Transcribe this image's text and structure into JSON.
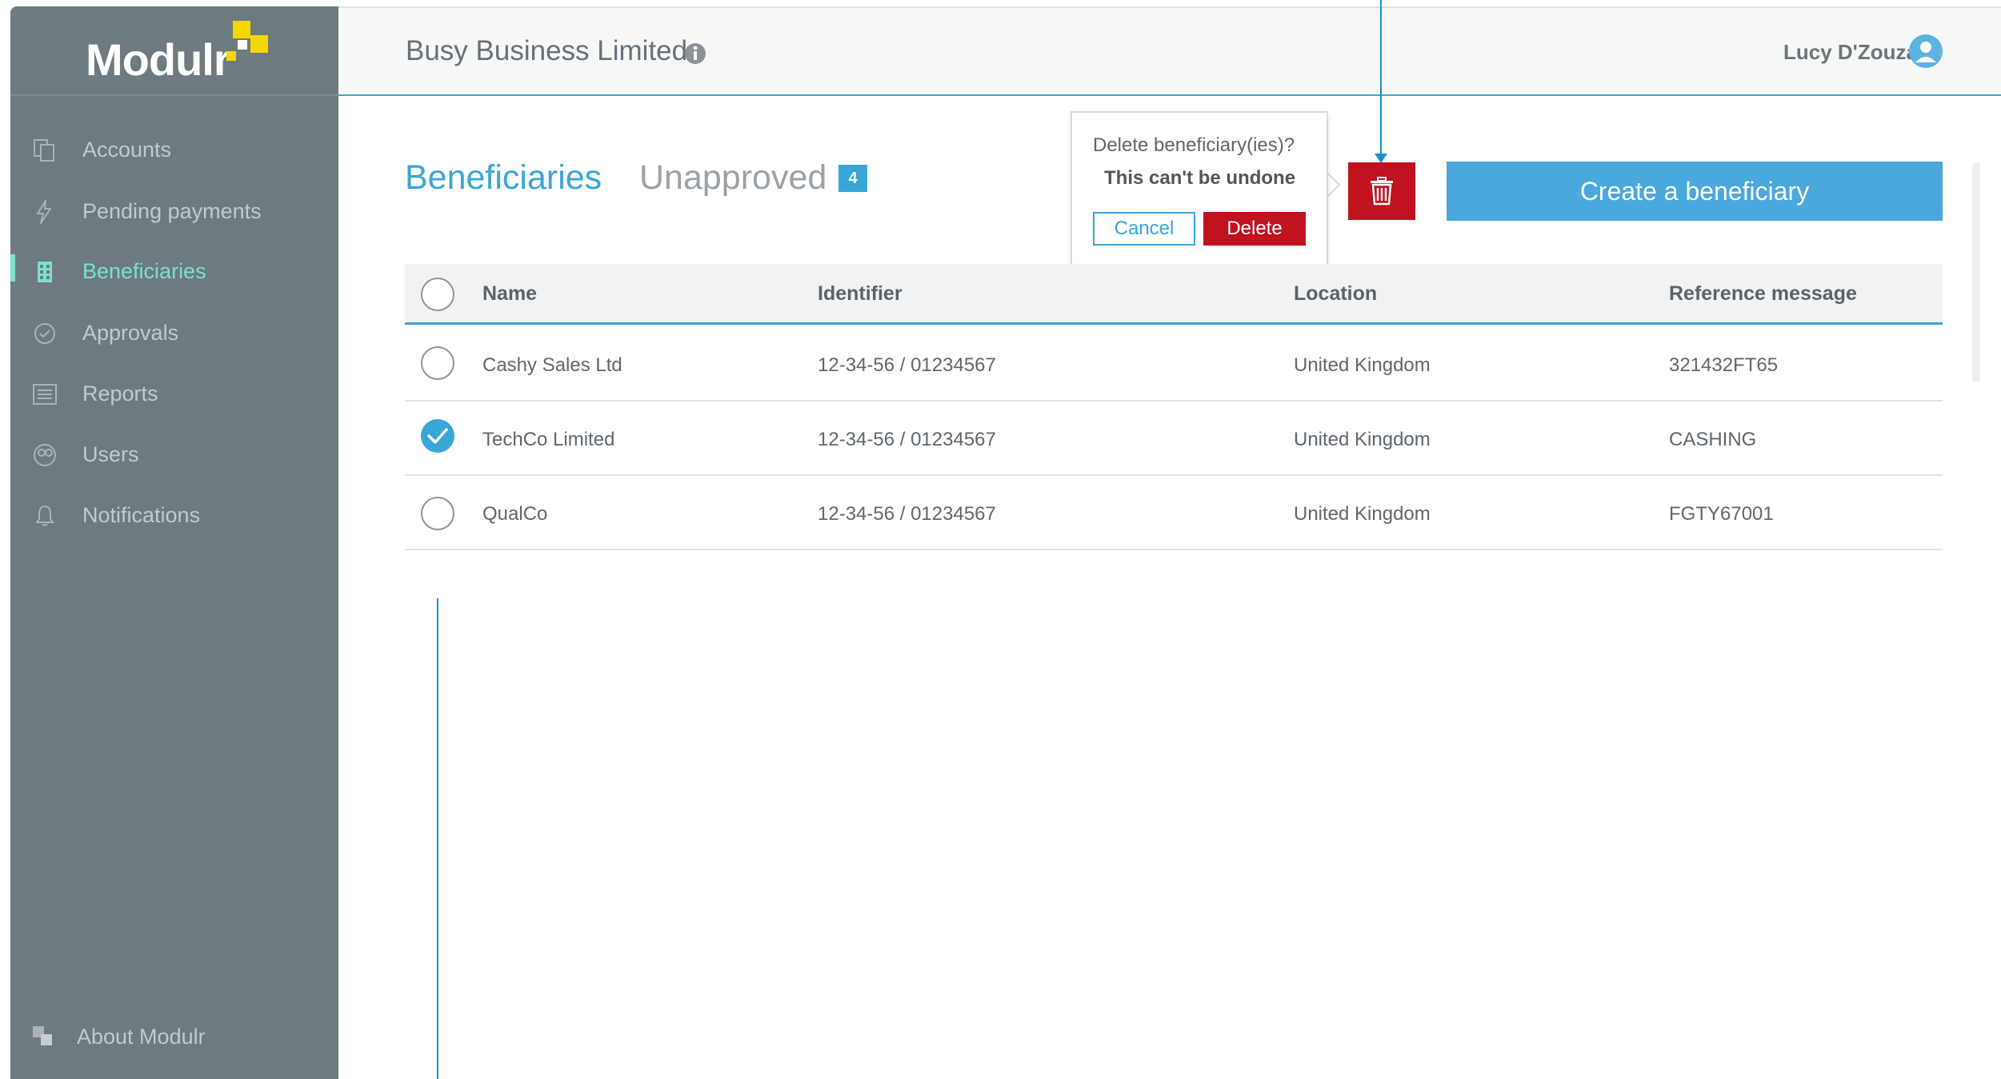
{
  "sidebar": {
    "logo": "Modulr",
    "items": [
      {
        "label": "Accounts",
        "icon": "accounts-icon"
      },
      {
        "label": "Pending payments",
        "icon": "lightning-icon"
      },
      {
        "label": "Beneficiaries",
        "icon": "building-icon",
        "active": true
      },
      {
        "label": "Approvals",
        "icon": "check-circle-icon"
      },
      {
        "label": "Reports",
        "icon": "report-icon"
      },
      {
        "label": "Users",
        "icon": "users-icon"
      },
      {
        "label": "Notifications",
        "icon": "bell-icon"
      }
    ],
    "about": "About Modulr"
  },
  "header": {
    "company": "Busy Business Limited",
    "user": "Lucy D'Zouza"
  },
  "tabs": {
    "beneficiaries": "Beneficiaries",
    "unapproved": "Unapproved",
    "unapproved_count": "4"
  },
  "popover": {
    "question": "Delete beneficiary(ies)?",
    "warning": "This can't be undone",
    "cancel": "Cancel",
    "delete": "Delete"
  },
  "actions": {
    "create": "Create a beneficiary"
  },
  "table": {
    "headers": [
      "Name",
      "Identifier",
      "Location",
      "Reference message"
    ],
    "rows": [
      {
        "name": "Cashy Sales Ltd",
        "identifier": "12-34-56 / 01234567",
        "location": "United Kingdom",
        "reference": "321432FT65",
        "checked": false
      },
      {
        "name": "TechCo Limited",
        "identifier": "12-34-56 / 01234567",
        "location": "United Kingdom",
        "reference": "CASHING",
        "checked": true
      },
      {
        "name": "QualCo",
        "identifier": "12-34-56 / 01234567",
        "location": "United Kingdom",
        "reference": "FGTY67001",
        "checked": false
      }
    ]
  },
  "colors": {
    "sidebar": "#6d7a80",
    "accent": "#3aa6d6",
    "active": "#7ee0ce",
    "danger": "#c1121f",
    "logo_mark": "#f5d800"
  }
}
